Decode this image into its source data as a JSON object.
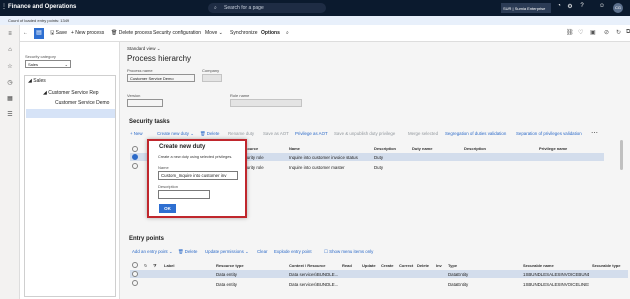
{
  "app": {
    "title": "Finance and Operations",
    "search_placeholder": "Search for a page",
    "company": "SUR | Sumia Enterprise",
    "user_initials": "CG"
  },
  "message_bar": {
    "text": "Count of loaded entry points: 1349"
  },
  "toolbar": {
    "save": "Save",
    "new_process": "+ New process",
    "delete_process": "Delete process",
    "security_configuration": "Security configuration",
    "move": "Move",
    "synchronize": "Synchronize",
    "options": "Options"
  },
  "left_pane": {
    "label": "Security category",
    "select_value": "Sales",
    "tree": [
      {
        "label": "Sales"
      },
      {
        "label": "Customer Service Rep"
      },
      {
        "label": "Customer Service Demo"
      }
    ]
  },
  "main": {
    "view": "Standard view",
    "title": "Process hierarchy",
    "process_name_label": "Process name",
    "process_name_value": "Customer Service Demo",
    "company_label": "Company",
    "version_label": "Version",
    "role_name_label": "Role name"
  },
  "security_tasks": {
    "title": "Security tasks",
    "toolbar": {
      "new": "New",
      "create_new_duty": "Create new duty",
      "delete": "Delete",
      "rename": "Rename duty",
      "save_as_aot": "Save as AOT",
      "privilege_as_aot": "Privilege as AOT",
      "save_unpublished": "Save & unpublish duty privilege",
      "merge_selected": "Merge selected",
      "segregation": "Segregation of duties validation",
      "separation": "Separation of privileges validation"
    },
    "columns": [
      "Resource",
      "Name",
      "Description",
      "Duty name",
      "Description",
      "Privilege name"
    ],
    "rows": [
      {
        "resource": "security role",
        "name": "Inquire into customer invoice status",
        "description": "Duty"
      },
      {
        "resource": "security role",
        "name": "Inquire into customer master",
        "description": "Duty"
      }
    ]
  },
  "dialog": {
    "title": "Create new duty",
    "description": "Create a new duty using selected privileges.",
    "name_label": "Name",
    "name_value": "Custom_Inquire into customer inv",
    "description_label": "Description",
    "ok": "OK"
  },
  "entry_points": {
    "title": "Entry points",
    "toolbar": {
      "add": "Add an entry point",
      "delete": "Delete",
      "update_permissions": "Update permissions",
      "clear": "Clear",
      "explode": "Explode entry point",
      "show_menu_items": "Show menu items only"
    },
    "columns": [
      "Label",
      "Resource type",
      "Context \\ Resource",
      "Read",
      "Update",
      "Create",
      "Correct",
      "Delete",
      "Inv",
      "Type",
      "Securable name",
      "Securable type"
    ],
    "rows": [
      {
        "resource_type": "Data entity",
        "context": "Data services\\BUNDLE...",
        "type": "DataEntity",
        "securable_name": "1SBUNDLESALESINVOICEBUNDLE..."
      },
      {
        "resource_type": "Data entity",
        "context": "Data services\\BUNDLE...",
        "type": "DataEntity",
        "securable_name": "1SBUNDLESALESINVOICELINES..."
      }
    ]
  }
}
